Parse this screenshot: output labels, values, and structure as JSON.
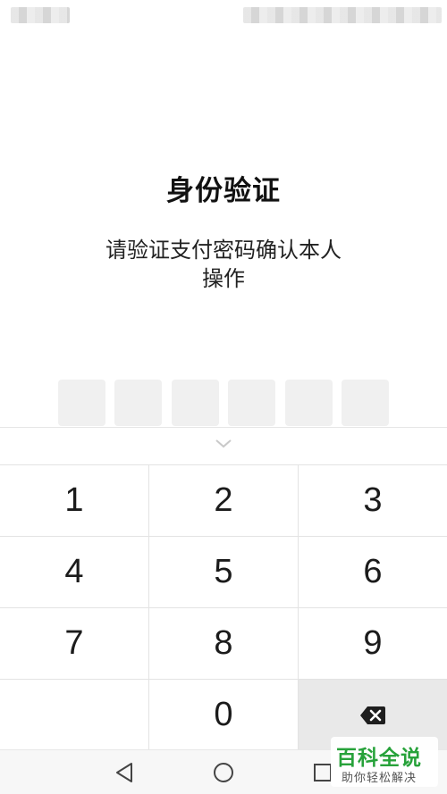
{
  "page": {
    "title": "身份验证",
    "subtitle_line1": "请验证支付密码确认本人",
    "subtitle_line2": "操作"
  },
  "pin": {
    "length": 6,
    "entered": 0
  },
  "keypad": {
    "keys": [
      "1",
      "2",
      "3",
      "4",
      "5",
      "6",
      "7",
      "8",
      "9",
      "",
      "0",
      "delete"
    ]
  },
  "icons": {
    "collapse": "chevron-down-icon",
    "delete": "backspace-icon",
    "nav_back": "triangle-back-icon",
    "nav_home": "circle-home-icon",
    "nav_recents": "square-recents-icon"
  },
  "watermark": {
    "main": "百科全说",
    "sub": "助你轻松解决",
    "color": "#27a23a"
  }
}
